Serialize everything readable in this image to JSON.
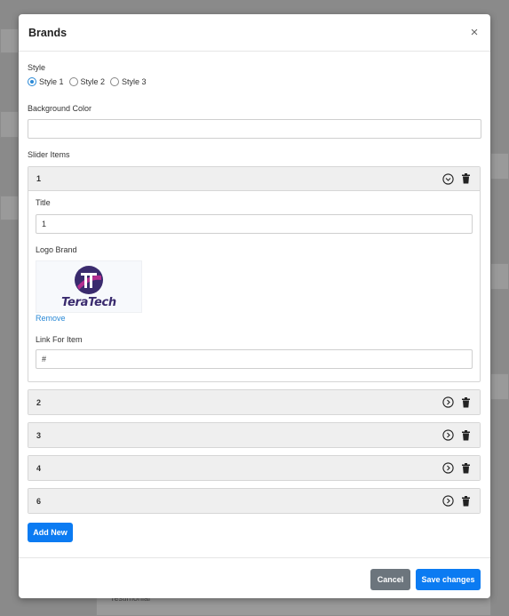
{
  "modal": {
    "title": "Brands",
    "close_symbol": "×"
  },
  "style": {
    "label": "Style",
    "options": [
      "Style 1",
      "Style 2",
      "Style 3"
    ],
    "selected": "Style 1"
  },
  "background_color": {
    "label": "Background Color",
    "value": ""
  },
  "slider_items": {
    "label": "Slider Items",
    "items": [
      {
        "number": "1",
        "expanded": true,
        "title_label": "Title",
        "title_value": "1",
        "logo_label": "Logo Brand",
        "logo_text": "TeraTech",
        "remove_label": "Remove",
        "link_label": "Link For Item",
        "link_value": "#"
      },
      {
        "number": "2",
        "expanded": false
      },
      {
        "number": "3",
        "expanded": false
      },
      {
        "number": "4",
        "expanded": false
      },
      {
        "number": "6",
        "expanded": false
      }
    ]
  },
  "buttons": {
    "add_new": "Add New",
    "cancel": "Cancel",
    "save": "Save changes"
  },
  "background_page": {
    "text": "Testimonial"
  },
  "icons": {
    "expand": "chevron-circle-icon",
    "delete": "trash-icon",
    "close": "close-icon"
  },
  "colors": {
    "primary": "#0b7bf2",
    "secondary": "#6c757d",
    "link": "#2a89d6",
    "logo_purple": "#3a2b6e",
    "logo_magenta": "#b32d8f"
  }
}
